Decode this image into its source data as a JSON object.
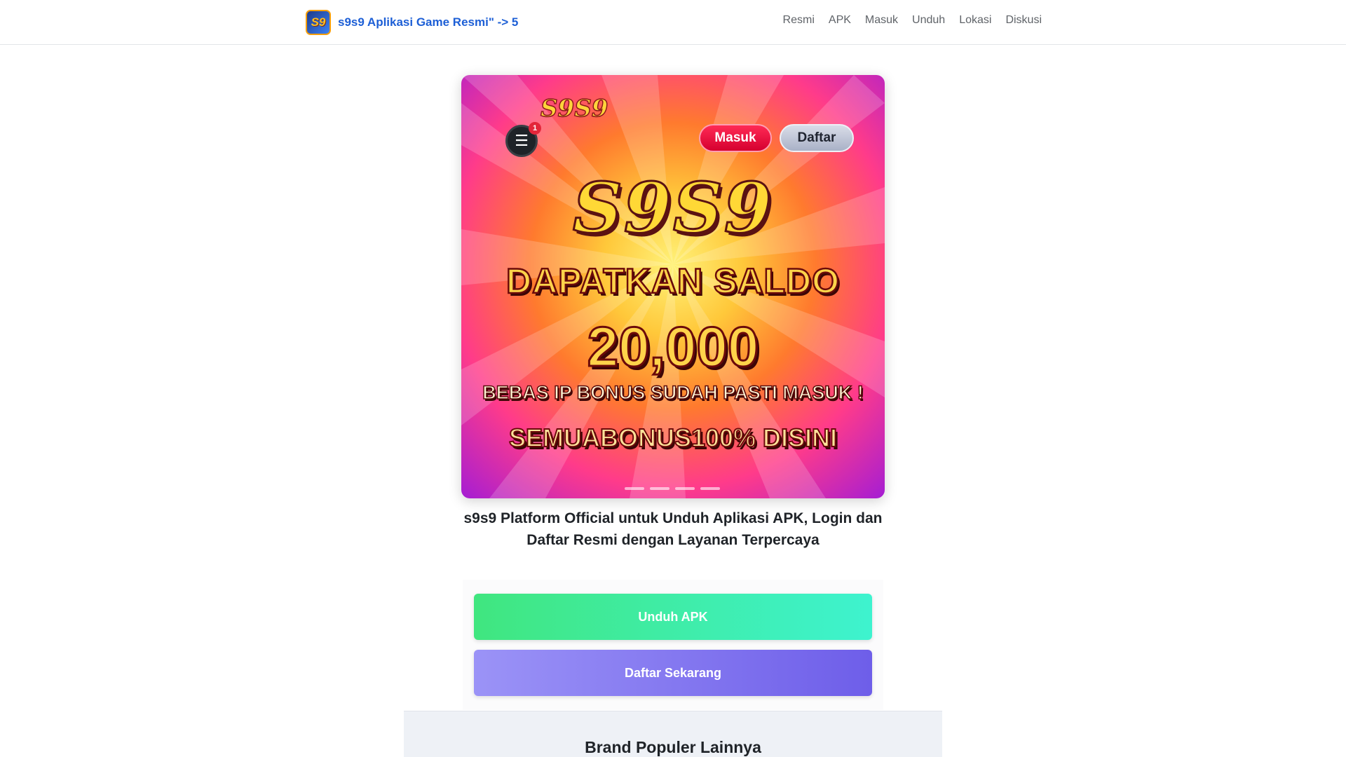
{
  "header": {
    "brand_logo_text": "S9",
    "brand_title": "s9s9 Aplikasi Game Resmi\" -> 5",
    "nav": [
      "Resmi",
      "APK",
      "Masuk",
      "Unduh",
      "Lokasi",
      "Diskusi"
    ]
  },
  "banner": {
    "small_logo": "S9S9",
    "menu_badge": "1",
    "login_label": "Masuk",
    "register_label": "Daftar",
    "big_logo": "S9S9",
    "line1": "DAPATKAN SALDO",
    "line2": "20,000",
    "line3": "BEBAS IP BONUS SUDAH PASTI MASUK !",
    "line4": "SEMUABONUS100% DISINI",
    "slide_count": 4
  },
  "tagline": "s9s9 Platform Official untuk Unduh Aplikasi APK, Login dan Daftar Resmi dengan Layanan Terpercaya",
  "buttons": {
    "download": "Unduh APK",
    "register": "Daftar Sekarang"
  },
  "section": {
    "title": "Brand Populer Lainnya"
  },
  "colors": {
    "brand_link": "#1d5fd6",
    "download_gradient": [
      "#40e67f",
      "#3ef3cf"
    ],
    "register_gradient": [
      "#9b93f7",
      "#6e5ee9"
    ]
  }
}
